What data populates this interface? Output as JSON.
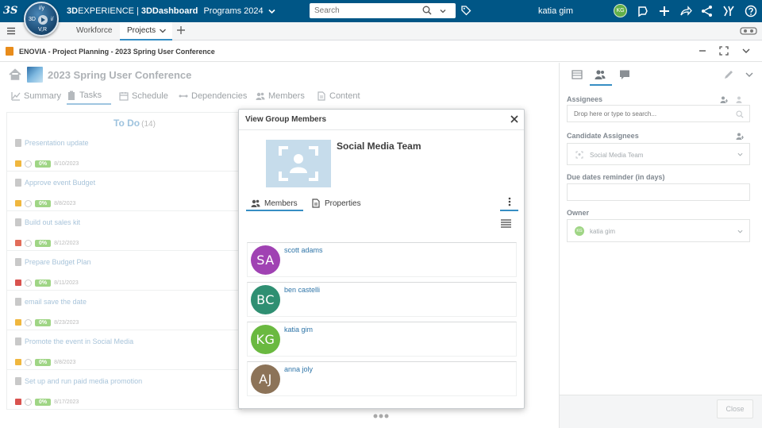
{
  "topbar": {
    "brand_logo": "3S",
    "compass_labels": {
      "top": "i/y",
      "left": "3D",
      "right": "i/",
      "bottom": "V,R"
    },
    "app_brand": "3D",
    "app_brand_rest": "EXPERIENCE",
    "separator": "|",
    "dashboard_prefix": "3D",
    "dashboard_rest": "Dashboard",
    "dashboard_name": "Programs 2024",
    "search_placeholder": "Search",
    "user_name": "katia gim",
    "user_initials": "KG",
    "accent_color": "#005686"
  },
  "secbar": {
    "tabs": [
      {
        "label": "Workforce"
      },
      {
        "label": "Projects"
      }
    ]
  },
  "appbar": {
    "path": "ENOVIA - Project Planning - 2023 Spring User Conference"
  },
  "project": {
    "title": "2023 Spring User Conference",
    "nav_tabs": [
      {
        "label": "Summary"
      },
      {
        "label": "Tasks"
      },
      {
        "label": "Schedule"
      },
      {
        "label": "Dependencies"
      },
      {
        "label": "Members"
      },
      {
        "label": "Content"
      }
    ]
  },
  "todo": {
    "heading": "To Do",
    "count": "(14)",
    "tasks": [
      {
        "title": "Presentation update",
        "pct": "0%",
        "date": "8/10/2023",
        "status_color": "#f0b73e"
      },
      {
        "title": "Approve event Budget",
        "pct": "0%",
        "date": "8/8/2023",
        "status_color": "#f0b73e"
      },
      {
        "title": "Build out sales kit",
        "pct": "0%",
        "date": "8/12/2023",
        "status_color": "#e26d5a"
      },
      {
        "title": "Prepare Budget Plan",
        "pct": "0%",
        "date": "8/11/2023",
        "status_color": "#d9534f"
      },
      {
        "title": "email save the date",
        "pct": "0%",
        "date": "8/23/2023",
        "status_color": "#f0b73e"
      },
      {
        "title": "Promote the event in Social Media",
        "pct": "0%",
        "date": "8/8/2023",
        "status_color": "#f0b73e"
      },
      {
        "title": "Set up and run paid media promotion",
        "pct": "0%",
        "date": "8/17/2023",
        "status_color": "#d9534f"
      }
    ]
  },
  "modal": {
    "title": "View Group Members",
    "group_name": "Social Media Team",
    "tabs": [
      {
        "label": "Members"
      },
      {
        "label": "Properties"
      }
    ],
    "members": [
      {
        "initials": "SA",
        "name": "scott adams",
        "color": "#a042b3"
      },
      {
        "initials": "BC",
        "name": "ben castelli",
        "color": "#2f8f72"
      },
      {
        "initials": "KG",
        "name": "katia gim",
        "color": "#6ab940"
      },
      {
        "initials": "AJ",
        "name": "anna joly",
        "color": "#8c7358"
      }
    ]
  },
  "right_panel": {
    "assignees_label": "Assignees",
    "assignees_placeholder": "Drop here or type to search...",
    "candidate_label": "Candidate Assignees",
    "candidate_value": "Social Media Team",
    "due_label": "Due dates reminder (in days)",
    "due_value": "",
    "owner_label": "Owner",
    "owner_value": "katia gim",
    "owner_initials": "KG",
    "close_label": "Close"
  }
}
